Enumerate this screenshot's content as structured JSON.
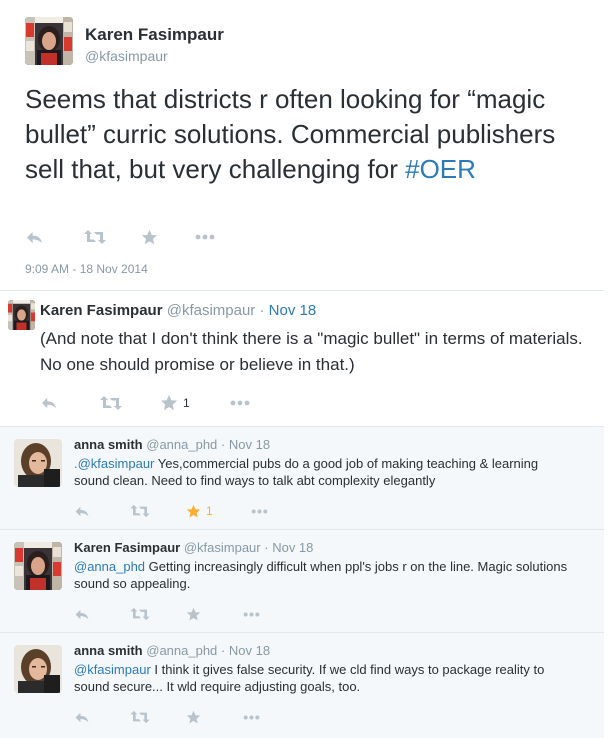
{
  "main_tweet": {
    "author_name": "Karen Fasimpaur",
    "author_handle": "@kfasimpaur",
    "text_before": "Seems that districts r often looking for “magic bullet” curric solutions. Commercial publishers sell that, but very challenging for ",
    "hashtag": "#OER",
    "timestamp": "9:09 AM - 18 Nov 2014",
    "avatar": "karen-avatar"
  },
  "reply_1": {
    "author_name": "Karen Fasimpaur",
    "author_handle": "@kfasimpaur",
    "separator": "·",
    "date": "Nov 18",
    "text": "(And note that I don't think there is a \"magic bullet\" in terms of materials. No one should promise or believe in that.)",
    "favorite_count": "1",
    "avatar": "karen-avatar"
  },
  "reply_2": {
    "author_name": "anna smith",
    "author_handle": "@anna_phd",
    "separator": "·",
    "date": "Nov 18",
    "mention": ".@kfasimpaur",
    "text": " Yes,commercial pubs do a good job of making teaching & learning sound clean. Need to find ways to talk abt complexity elegantly",
    "favorite_count": "1",
    "favorited": true,
    "avatar": "anna-avatar"
  },
  "reply_3": {
    "author_name": "Karen Fasimpaur",
    "author_handle": "@kfasimpaur",
    "separator": "·",
    "date": "Nov 18",
    "mention": "@anna_phd",
    "text": " Getting increasingly difficult when ppl's jobs r on the line. Magic solutions sound so appealing.",
    "avatar": "karen-avatar"
  },
  "reply_4": {
    "author_name": "anna smith",
    "author_handle": "@anna_phd",
    "separator": "·",
    "date": "Nov 18",
    "mention": "@kfasimpaur",
    "text": " I think it gives false security. If we cld find ways to package reality to sound secure... It wld require adjusting goals, too.",
    "avatar": "anna-avatar"
  },
  "colors": {
    "link": "#2b7bb9",
    "muted": "#8899a6",
    "action_icon": "#b8c3cc",
    "favorite_active": "#ffac33",
    "conversation_bg": "#f5f8fa"
  }
}
